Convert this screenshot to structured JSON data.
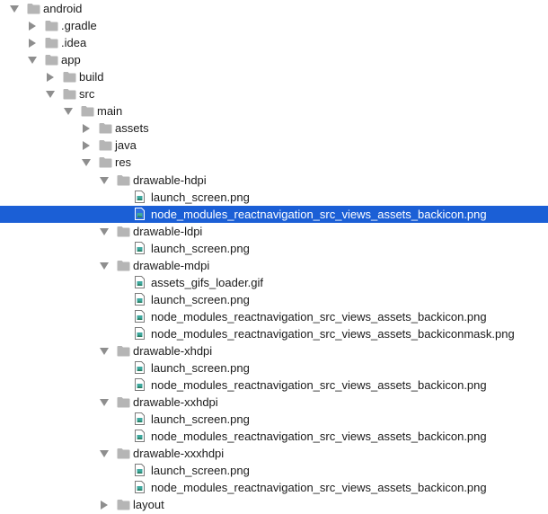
{
  "colors": {
    "selection": "#1b5fd6",
    "folder": "#b5b5b5",
    "disclosure": "#8e8e8e"
  },
  "tree": [
    {
      "depth": 0,
      "kind": "folder",
      "state": "expanded",
      "label": "android"
    },
    {
      "depth": 1,
      "kind": "folder",
      "state": "collapsed",
      "label": ".gradle"
    },
    {
      "depth": 1,
      "kind": "folder",
      "state": "collapsed",
      "label": ".idea"
    },
    {
      "depth": 1,
      "kind": "folder",
      "state": "expanded",
      "label": "app"
    },
    {
      "depth": 2,
      "kind": "folder",
      "state": "collapsed",
      "label": "build"
    },
    {
      "depth": 2,
      "kind": "folder",
      "state": "expanded",
      "label": "src"
    },
    {
      "depth": 3,
      "kind": "folder",
      "state": "expanded",
      "label": "main"
    },
    {
      "depth": 4,
      "kind": "folder",
      "state": "collapsed",
      "label": "assets"
    },
    {
      "depth": 4,
      "kind": "folder",
      "state": "collapsed",
      "label": "java"
    },
    {
      "depth": 4,
      "kind": "folder",
      "state": "expanded",
      "label": "res"
    },
    {
      "depth": 5,
      "kind": "folder",
      "state": "expanded",
      "label": "drawable-hdpi"
    },
    {
      "depth": 6,
      "kind": "file",
      "label": "launch_screen.png"
    },
    {
      "depth": 6,
      "kind": "file",
      "selected": true,
      "label": "node_modules_reactnavigation_src_views_assets_backicon.png"
    },
    {
      "depth": 5,
      "kind": "folder",
      "state": "expanded",
      "label": "drawable-ldpi"
    },
    {
      "depth": 6,
      "kind": "file",
      "label": "launch_screen.png"
    },
    {
      "depth": 5,
      "kind": "folder",
      "state": "expanded",
      "label": "drawable-mdpi"
    },
    {
      "depth": 6,
      "kind": "file",
      "label": "assets_gifs_loader.gif"
    },
    {
      "depth": 6,
      "kind": "file",
      "label": "launch_screen.png"
    },
    {
      "depth": 6,
      "kind": "file",
      "label": "node_modules_reactnavigation_src_views_assets_backicon.png"
    },
    {
      "depth": 6,
      "kind": "file",
      "label": "node_modules_reactnavigation_src_views_assets_backiconmask.png"
    },
    {
      "depth": 5,
      "kind": "folder",
      "state": "expanded",
      "label": "drawable-xhdpi"
    },
    {
      "depth": 6,
      "kind": "file",
      "label": "launch_screen.png"
    },
    {
      "depth": 6,
      "kind": "file",
      "label": "node_modules_reactnavigation_src_views_assets_backicon.png"
    },
    {
      "depth": 5,
      "kind": "folder",
      "state": "expanded",
      "label": "drawable-xxhdpi"
    },
    {
      "depth": 6,
      "kind": "file",
      "label": "launch_screen.png"
    },
    {
      "depth": 6,
      "kind": "file",
      "label": "node_modules_reactnavigation_src_views_assets_backicon.png"
    },
    {
      "depth": 5,
      "kind": "folder",
      "state": "expanded",
      "label": "drawable-xxxhdpi"
    },
    {
      "depth": 6,
      "kind": "file",
      "label": "launch_screen.png"
    },
    {
      "depth": 6,
      "kind": "file",
      "label": "node_modules_reactnavigation_src_views_assets_backicon.png"
    },
    {
      "depth": 5,
      "kind": "folder",
      "state": "collapsed",
      "label": "layout"
    }
  ]
}
